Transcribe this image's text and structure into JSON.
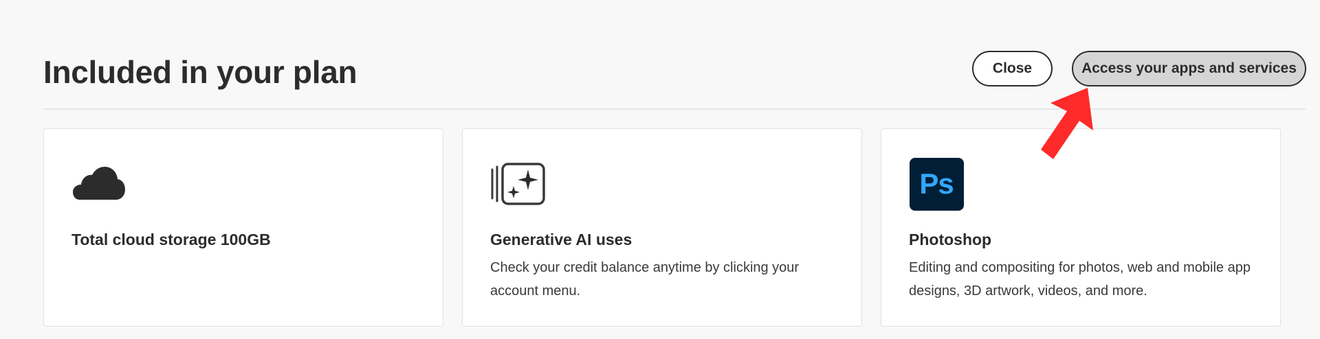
{
  "header": {
    "title": "Included in your plan",
    "close_label": "Close",
    "access_label": "Access your apps and services"
  },
  "cards": [
    {
      "icon": "cloud-icon",
      "title": "Total cloud storage 100GB",
      "description": ""
    },
    {
      "icon": "generative-ai-icon",
      "title": "Generative AI uses",
      "description": "Check your credit balance anytime by clicking your account menu."
    },
    {
      "icon": "photoshop-icon",
      "icon_text": "Ps",
      "title": "Photoshop",
      "description": "Editing and compositing for photos, web and mobile app designs, 3D artwork, videos, and more."
    }
  ],
  "colors": {
    "background": "#f8f8f8",
    "text": "#2c2c2c",
    "access_button_bg": "#d5d5d5",
    "ps_bg": "#001e36",
    "ps_text": "#31a8ff",
    "pointer_arrow": "#ff2a2a"
  }
}
